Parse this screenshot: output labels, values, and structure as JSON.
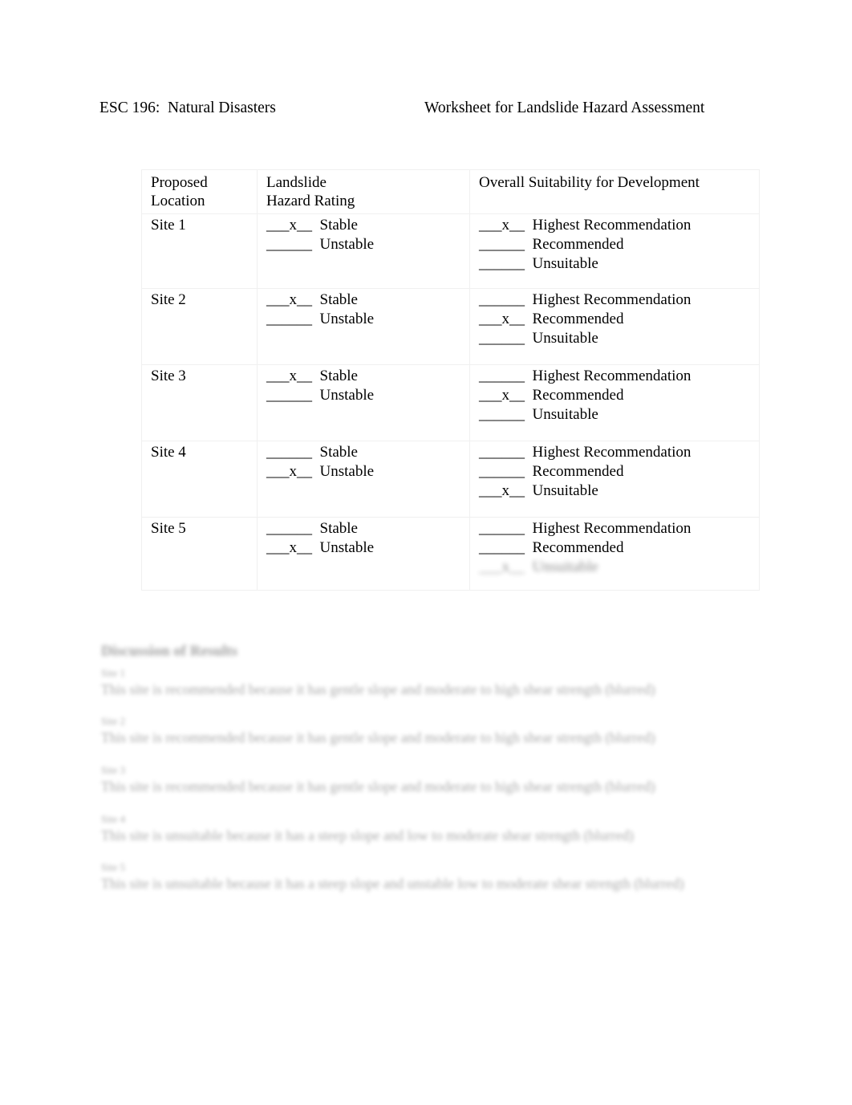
{
  "header": {
    "course": "ESC 196:  Natural Disasters",
    "worksheet_title": "Worksheet for Landslide Hazard Assessment"
  },
  "table": {
    "columns": [
      {
        "line1": "Proposed",
        "line2": "Location"
      },
      {
        "line1": "Landslide",
        "line2": "Hazard Rating"
      },
      {
        "line1": "Overall Suitability for Development",
        "line2": ""
      }
    ],
    "blank_unmarked": "______",
    "blank_marked": "___x__",
    "rating_options": [
      "Stable",
      "Unstable"
    ],
    "suitability_options": [
      "Highest Recommendation",
      "Recommended",
      "Unsuitable"
    ],
    "rows": [
      {
        "location": "Site 1",
        "rating": [
          {
            "label": "Stable",
            "blank": "___x__",
            "marked": true
          },
          {
            "label": "Unstable",
            "blank": "______",
            "marked": false
          }
        ],
        "suitability": [
          {
            "label": "Highest Recommendation",
            "blank": "___x__",
            "marked": true
          },
          {
            "label": "Recommended",
            "blank": "______",
            "marked": false
          },
          {
            "label": "Unsuitable",
            "blank": "______",
            "marked": false
          }
        ]
      },
      {
        "location": "Site 2",
        "rating": [
          {
            "label": "Stable",
            "blank": "___x__",
            "marked": true
          },
          {
            "label": "Unstable",
            "blank": "______",
            "marked": false
          }
        ],
        "suitability": [
          {
            "label": "Highest Recommendation",
            "blank": "______",
            "marked": false
          },
          {
            "label": "Recommended",
            "blank": "___x__",
            "marked": true
          },
          {
            "label": "Unsuitable",
            "blank": "______",
            "marked": false
          }
        ]
      },
      {
        "location": "Site 3",
        "rating": [
          {
            "label": "Stable",
            "blank": "___x__",
            "marked": true
          },
          {
            "label": "Unstable",
            "blank": "______",
            "marked": false
          }
        ],
        "suitability": [
          {
            "label": "Highest Recommendation",
            "blank": "______",
            "marked": false
          },
          {
            "label": "Recommended",
            "blank": "___x__",
            "marked": true
          },
          {
            "label": "Unsuitable",
            "blank": "______",
            "marked": false
          }
        ]
      },
      {
        "location": "Site 4",
        "rating": [
          {
            "label": "Stable",
            "blank": "______",
            "marked": false
          },
          {
            "label": "Unstable",
            "blank": "___x__",
            "marked": true
          }
        ],
        "suitability": [
          {
            "label": "Highest Recommendation",
            "blank": "______",
            "marked": false
          },
          {
            "label": "Recommended",
            "blank": "______",
            "marked": false
          },
          {
            "label": "Unsuitable",
            "blank": "___x__",
            "marked": true
          }
        ]
      },
      {
        "location": "Site 5",
        "rating": [
          {
            "label": "Stable",
            "blank": "______",
            "marked": false
          },
          {
            "label": "Unstable",
            "blank": "___x__",
            "marked": true
          }
        ],
        "suitability": [
          {
            "label": "Highest Recommendation",
            "blank": "______",
            "marked": false
          },
          {
            "label": "Recommended",
            "blank": "______",
            "marked": false
          },
          {
            "label": "Unsuitable",
            "blank": "___x__",
            "marked": true,
            "obscured": true
          }
        ]
      }
    ]
  },
  "discussion": {
    "section_title": "Discussion of Results",
    "blocks": [
      {
        "label": "Site 1",
        "text": "This site is recommended because it has gentle slope and moderate to high shear strength (blurred)"
      },
      {
        "label": "Site 2",
        "text": "This site is recommended because it has gentle slope and moderate to high shear strength (blurred)"
      },
      {
        "label": "Site 3",
        "text": "This site is recommended because it has gentle slope and moderate to high shear strength (blurred)"
      },
      {
        "label": "Site 4",
        "text": "This site is unsuitable because it has a steep slope and low to moderate shear strength (blurred)"
      },
      {
        "label": "Site 5",
        "text": "This site is unsuitable because it has a steep slope and unstable low to moderate shear strength (blurred)"
      }
    ]
  }
}
